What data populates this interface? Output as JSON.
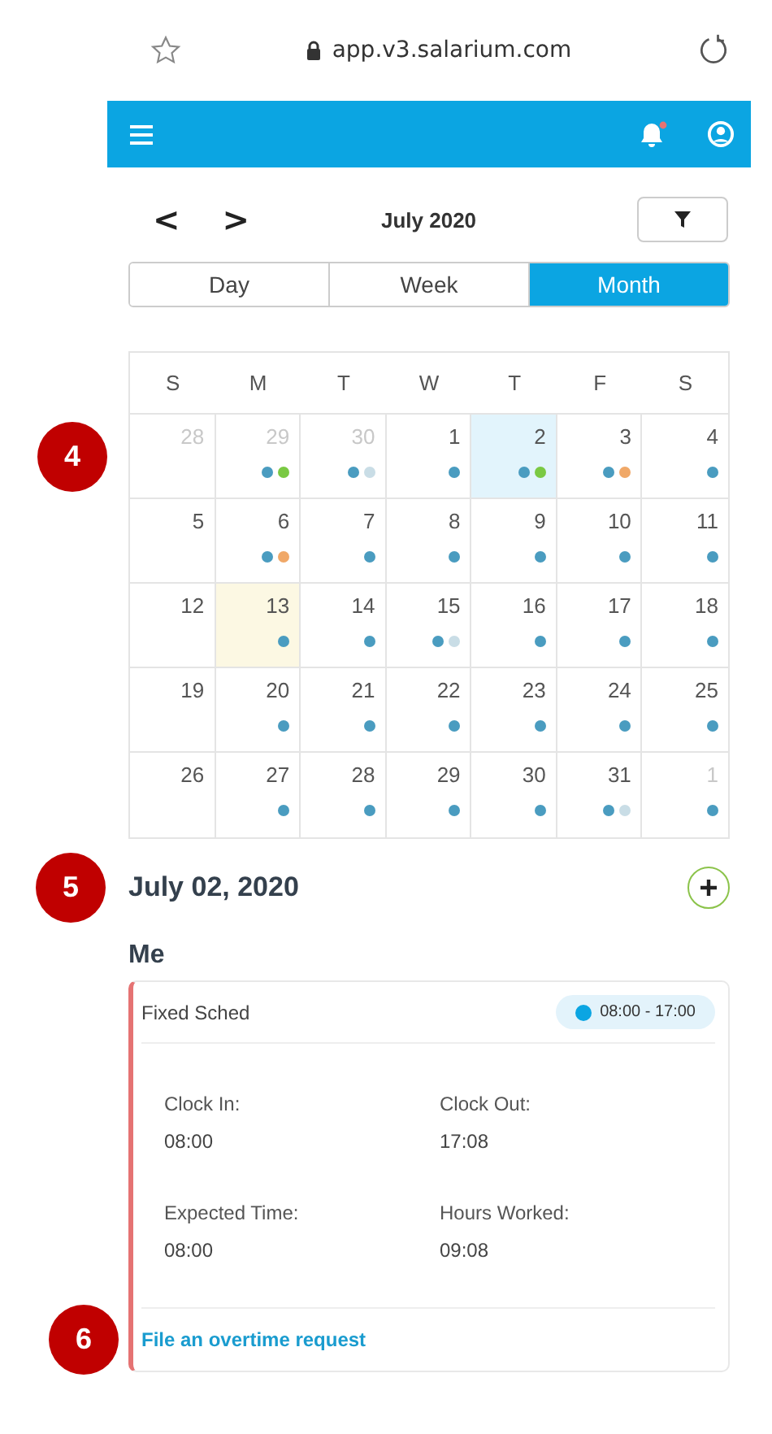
{
  "browser": {
    "url": "app.v3.salarium.com"
  },
  "nav": {
    "prev": "<",
    "next": ">",
    "title": "July 2020"
  },
  "view_tabs": [
    {
      "label": "Day",
      "selected": false
    },
    {
      "label": "Week",
      "selected": false
    },
    {
      "label": "Month",
      "selected": true
    }
  ],
  "calendar": {
    "weekdays": [
      "S",
      "M",
      "T",
      "W",
      "T",
      "F",
      "S"
    ],
    "days": [
      {
        "day": "28",
        "outside": true,
        "selected": false,
        "today": false
      },
      {
        "day": "29",
        "outside": true,
        "selected": false,
        "today": false,
        "dots": [
          {
            "color": "#4a9cc0"
          },
          {
            "color": "#7ac943"
          }
        ]
      },
      {
        "day": "30",
        "outside": true,
        "selected": false,
        "today": false,
        "dots": [
          {
            "color": "#4a9cc0"
          },
          {
            "color": "#c9dde6"
          }
        ]
      },
      {
        "day": "1",
        "outside": false,
        "selected": false,
        "today": false,
        "dots": [
          {
            "color": "#4a9cc0"
          }
        ]
      },
      {
        "day": "2",
        "outside": false,
        "selected": true,
        "today": false,
        "dots": [
          {
            "color": "#4a9cc0"
          },
          {
            "color": "#7ac943"
          }
        ]
      },
      {
        "day": "3",
        "outside": false,
        "selected": false,
        "today": false,
        "dots": [
          {
            "color": "#4a9cc0"
          },
          {
            "color": "#f0a868"
          }
        ]
      },
      {
        "day": "4",
        "outside": false,
        "selected": false,
        "today": false,
        "dots": [
          {
            "color": "#4a9cc0"
          }
        ]
      },
      {
        "day": "5",
        "outside": false,
        "selected": false,
        "today": false
      },
      {
        "day": "6",
        "outside": false,
        "selected": false,
        "today": false,
        "dots": [
          {
            "color": "#4a9cc0"
          },
          {
            "color": "#f0a868"
          }
        ]
      },
      {
        "day": "7",
        "outside": false,
        "selected": false,
        "today": false,
        "dots": [
          {
            "color": "#4a9cc0"
          }
        ]
      },
      {
        "day": "8",
        "outside": false,
        "selected": false,
        "today": false,
        "dots": [
          {
            "color": "#4a9cc0"
          }
        ]
      },
      {
        "day": "9",
        "outside": false,
        "selected": false,
        "today": false,
        "dots": [
          {
            "color": "#4a9cc0"
          }
        ]
      },
      {
        "day": "10",
        "outside": false,
        "selected": false,
        "today": false,
        "dots": [
          {
            "color": "#4a9cc0"
          }
        ]
      },
      {
        "day": "11",
        "outside": false,
        "selected": false,
        "today": false,
        "dots": [
          {
            "color": "#4a9cc0"
          }
        ]
      },
      {
        "day": "12",
        "outside": false,
        "selected": false,
        "today": false
      },
      {
        "day": "13",
        "outside": false,
        "selected": false,
        "today": true,
        "dots": [
          {
            "color": "#4a9cc0"
          }
        ]
      },
      {
        "day": "14",
        "outside": false,
        "selected": false,
        "today": false,
        "dots": [
          {
            "color": "#4a9cc0"
          }
        ]
      },
      {
        "day": "15",
        "outside": false,
        "selected": false,
        "today": false,
        "dots": [
          {
            "color": "#4a9cc0"
          },
          {
            "color": "#c9dde6"
          }
        ]
      },
      {
        "day": "16",
        "outside": false,
        "selected": false,
        "today": false,
        "dots": [
          {
            "color": "#4a9cc0"
          }
        ]
      },
      {
        "day": "17",
        "outside": false,
        "selected": false,
        "today": false,
        "dots": [
          {
            "color": "#4a9cc0"
          }
        ]
      },
      {
        "day": "18",
        "outside": false,
        "selected": false,
        "today": false,
        "dots": [
          {
            "color": "#4a9cc0"
          }
        ]
      },
      {
        "day": "19",
        "outside": false,
        "selected": false,
        "today": false
      },
      {
        "day": "20",
        "outside": false,
        "selected": false,
        "today": false,
        "dots": [
          {
            "color": "#4a9cc0"
          }
        ]
      },
      {
        "day": "21",
        "outside": false,
        "selected": false,
        "today": false,
        "dots": [
          {
            "color": "#4a9cc0"
          }
        ]
      },
      {
        "day": "22",
        "outside": false,
        "selected": false,
        "today": false,
        "dots": [
          {
            "color": "#4a9cc0"
          }
        ]
      },
      {
        "day": "23",
        "outside": false,
        "selected": false,
        "today": false,
        "dots": [
          {
            "color": "#4a9cc0"
          }
        ]
      },
      {
        "day": "24",
        "outside": false,
        "selected": false,
        "today": false,
        "dots": [
          {
            "color": "#4a9cc0"
          }
        ]
      },
      {
        "day": "25",
        "outside": false,
        "selected": false,
        "today": false,
        "dots": [
          {
            "color": "#4a9cc0"
          }
        ]
      },
      {
        "day": "26",
        "outside": false,
        "selected": false,
        "today": false
      },
      {
        "day": "27",
        "outside": false,
        "selected": false,
        "today": false,
        "dots": [
          {
            "color": "#4a9cc0"
          }
        ]
      },
      {
        "day": "28",
        "outside": false,
        "selected": false,
        "today": false,
        "dots": [
          {
            "color": "#4a9cc0"
          }
        ]
      },
      {
        "day": "29",
        "outside": false,
        "selected": false,
        "today": false,
        "dots": [
          {
            "color": "#4a9cc0"
          }
        ]
      },
      {
        "day": "30",
        "outside": false,
        "selected": false,
        "today": false,
        "dots": [
          {
            "color": "#4a9cc0"
          }
        ]
      },
      {
        "day": "31",
        "outside": false,
        "selected": false,
        "today": false,
        "dots": [
          {
            "color": "#4a9cc0"
          },
          {
            "color": "#c9dde6"
          }
        ]
      },
      {
        "day": "1",
        "outside": true,
        "selected": false,
        "today": false,
        "dots": [
          {
            "color": "#4a9cc0"
          }
        ]
      }
    ]
  },
  "selected_date": "July 02, 2020",
  "group": "Me",
  "card": {
    "title": "Fixed Sched",
    "time": "08:00 - 17:00",
    "fields": [
      {
        "label": "Clock In:",
        "value": "08:00"
      },
      {
        "label": "Clock Out:",
        "value": "17:08"
      },
      {
        "label": "Expected Time:",
        "value": "08:00"
      },
      {
        "label": "Hours Worked:",
        "value": "09:08"
      }
    ],
    "link": "File an overtime request"
  },
  "callouts": [
    "4",
    "5",
    "6"
  ]
}
